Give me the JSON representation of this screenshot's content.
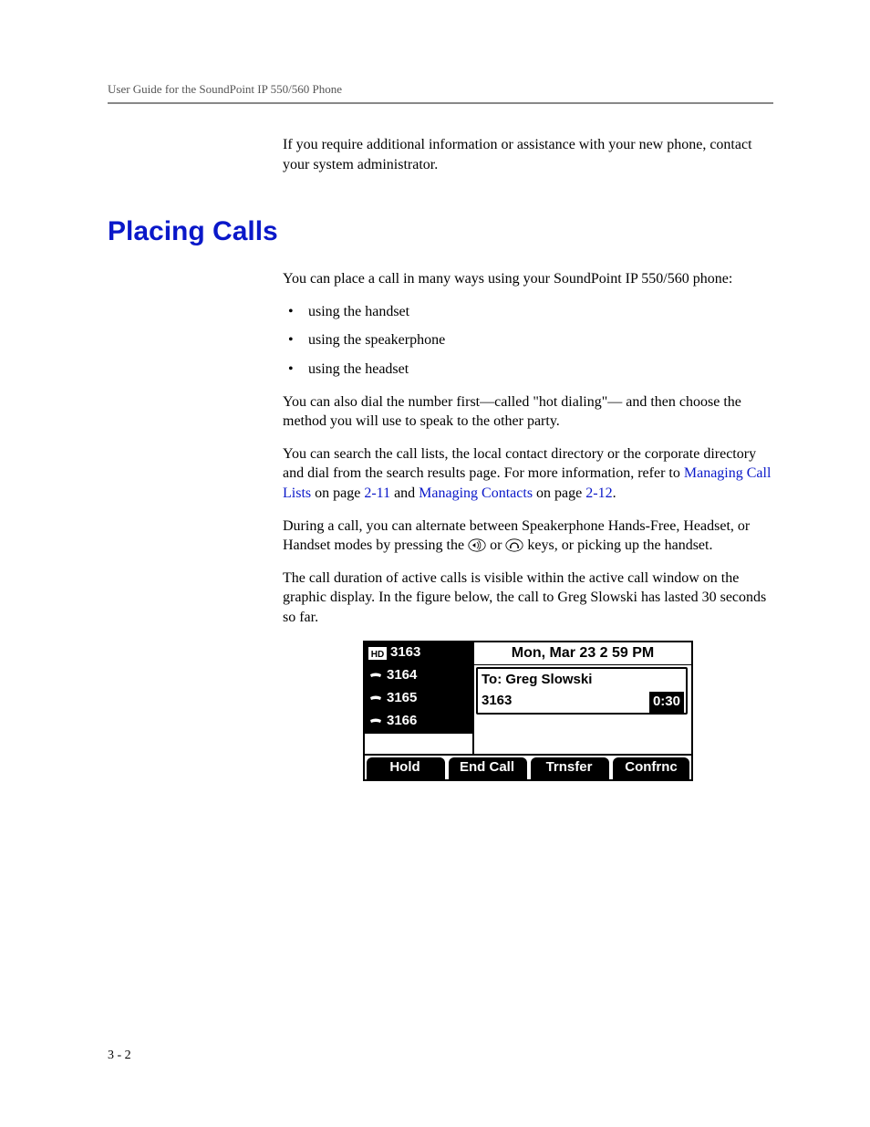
{
  "header": {
    "running_head": "User Guide for the SoundPoint IP 550/560 Phone"
  },
  "intro_para": "If you require additional information or assistance with your new phone, contact your system administrator.",
  "section_title": "Placing Calls",
  "p1": "You can place a call in many ways using your SoundPoint IP 550/560 phone:",
  "bullets": [
    "using the handset",
    "using the speakerphone",
    "using the headset"
  ],
  "p2": "You can also dial the number first—called \"hot dialing\"— and then choose the method you will use to speak to the other party.",
  "p3a": "You can search the call lists, the local contact directory or the corporate directory and dial from the search results page. For more information, refer to ",
  "link1": "Managing Call Lists",
  "p3b": " on page ",
  "pref1": "2-11",
  "p3c": " and ",
  "link2": "Managing Contacts",
  "p3d": " on page ",
  "pref2": "2-12",
  "p3e": ".",
  "p4a": "During a call, you can alternate between Speakerphone Hands-Free, Headset, or Handset modes by pressing the ",
  "p4b": " or ",
  "p4c": " keys, or picking up the handset.",
  "p5": "The call duration of active calls is visible within the active call window on the graphic display. In the figure below, the call to Greg Slowski has lasted 30 seconds so far.",
  "phone": {
    "datetime": "Mon, Mar 23  2 59 PM",
    "lines": [
      {
        "icon": "hd",
        "label": "3163"
      },
      {
        "icon": "phone",
        "label": "3164"
      },
      {
        "icon": "phone",
        "label": "3165"
      },
      {
        "icon": "phone",
        "label": "3166"
      }
    ],
    "call": {
      "to_label": "To: Greg Slowski",
      "from": "3163",
      "duration": "0:30"
    },
    "softkeys": [
      "Hold",
      "End Call",
      "Trnsfer",
      "Confrnc"
    ]
  },
  "page_number": "3 - 2"
}
